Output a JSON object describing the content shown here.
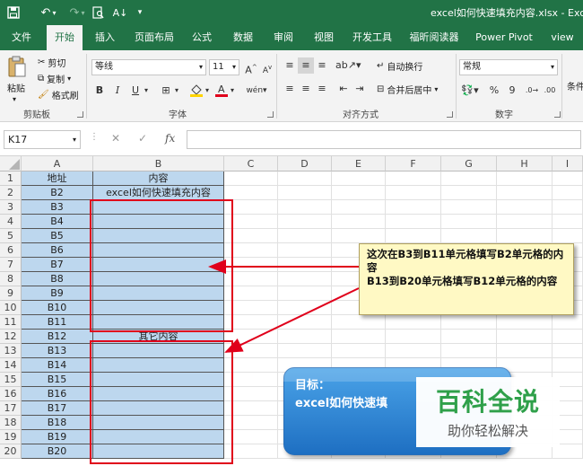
{
  "quick_access": {
    "save_icon": "save-icon",
    "undo_icon": "undo-icon",
    "redo_icon": "redo-icon",
    "preview_icon": "print-preview-icon",
    "sort_icon": "sort-icon",
    "customize_icon": "customize-icon"
  },
  "window": {
    "title": "excel如何快速填充内容.xlsx  -  Excel"
  },
  "tabs": [
    "文件",
    "开始",
    "插入",
    "页面布局",
    "公式",
    "数据",
    "审阅",
    "视图",
    "开发工具",
    "福昕阅读器",
    "Power Pivot",
    "view"
  ],
  "active_tab": "开始",
  "ribbon": {
    "clipboard": {
      "paste": "粘贴",
      "cut": "剪切",
      "copy": "复制",
      "format_painter": "格式刷",
      "label": "剪贴板"
    },
    "font": {
      "name": "等线",
      "size": "11",
      "grow": "A",
      "shrink": "A",
      "bold": "B",
      "italic": "I",
      "underline": "U",
      "label": "字体"
    },
    "alignment": {
      "wrap": "自动换行",
      "merge": "合并后居中",
      "label": "对齐方式"
    },
    "number": {
      "format": "常规",
      "percent": "%",
      "comma": "9",
      "label": "数字"
    },
    "styles": {
      "conditional": "条件"
    }
  },
  "formula_bar": {
    "name_box": "K17",
    "cancel": "✕",
    "enter": "✓",
    "fx": "fx",
    "value": ""
  },
  "columns": [
    "A",
    "B",
    "C",
    "D",
    "E",
    "F",
    "G",
    "H",
    "I"
  ],
  "rows": [
    "1",
    "2",
    "3",
    "4",
    "5",
    "6",
    "7",
    "8",
    "9",
    "10",
    "11",
    "12",
    "13",
    "14",
    "15",
    "16",
    "17",
    "18",
    "19",
    "20"
  ],
  "col_a": [
    "地址",
    "B2",
    "B3",
    "B4",
    "B5",
    "B6",
    "B7",
    "B8",
    "B9",
    "B10",
    "B11",
    "B12",
    "B13",
    "B14",
    "B15",
    "B16",
    "B17",
    "B18",
    "B19",
    "B20"
  ],
  "col_b": {
    "header": "内容",
    "b2": "excel如何快速填充内容",
    "b12": "其它内容"
  },
  "callout": {
    "line1": "这次在B3到B11单元格填写B2单元格的内容",
    "line2": "B13到B20单元格填写B12单元格的内容"
  },
  "goal": {
    "title": "目标：",
    "text": "excel如何快速填"
  },
  "watermark": {
    "big": "百科全说",
    "small": "助你轻松解决"
  },
  "colors": {
    "excel_green": "#217346",
    "cell_blue": "#bdd7ee",
    "annot_red": "#e0001b",
    "callout_bg": "#fff9c4",
    "goal_blue": "#1e6fc2",
    "watermark_green": "#2fa04a"
  }
}
